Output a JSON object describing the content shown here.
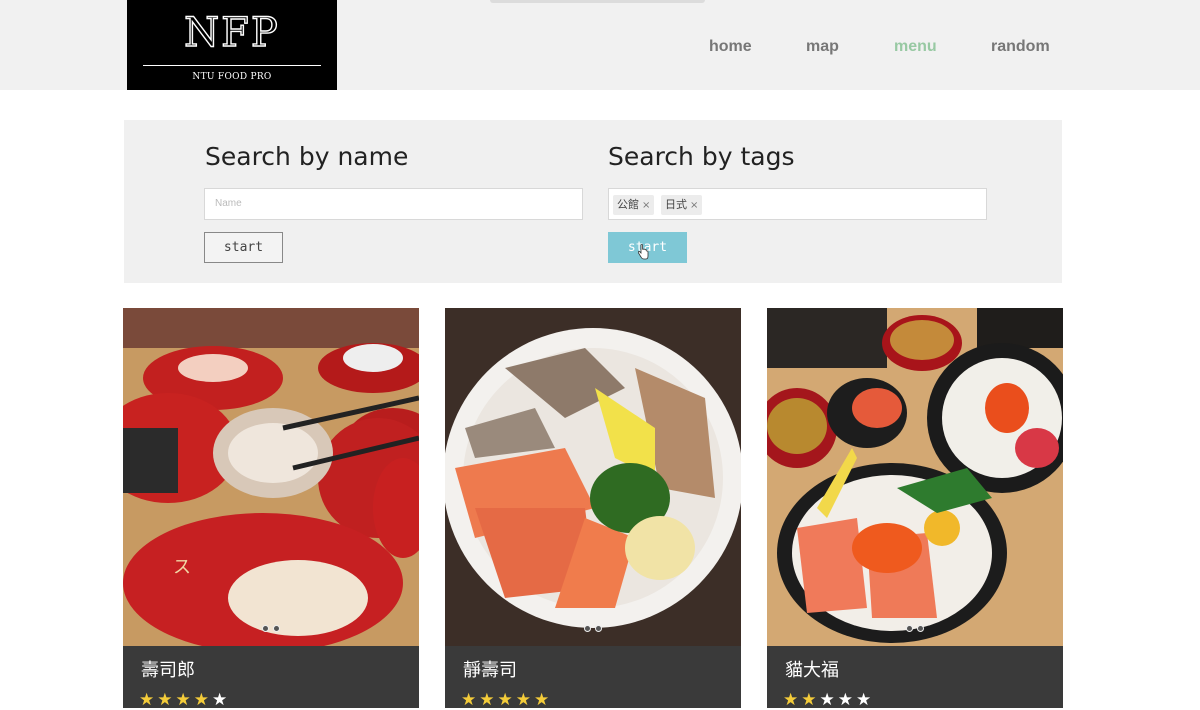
{
  "header": {
    "logo_mark": "NFP",
    "logo_sub": "NTU FOOD PRO",
    "nav": [
      {
        "label": "home",
        "active": false
      },
      {
        "label": "map",
        "active": false
      },
      {
        "label": "menu",
        "active": true
      },
      {
        "label": "random",
        "active": false
      }
    ],
    "active_color": "#98c9a3"
  },
  "search": {
    "by_name": {
      "title": "Search by name",
      "placeholder": "Name",
      "button": "start"
    },
    "by_tags": {
      "title": "Search by tags",
      "tags": [
        {
          "label": "公館",
          "remove": "×"
        },
        {
          "label": "日式",
          "remove": "×"
        }
      ],
      "button": "start",
      "button_color": "#7fc8d6"
    }
  },
  "cards": [
    {
      "name": "壽司郎",
      "rating": 4,
      "max_rating": 5,
      "image": "sushi-conveyor-photo"
    },
    {
      "name": "靜壽司",
      "rating": 5,
      "max_rating": 5,
      "image": "sashimi-platter-photo"
    },
    {
      "name": "貓大福",
      "rating": 2,
      "max_rating": 5,
      "image": "chirashi-don-photo"
    }
  ],
  "colors": {
    "star": "#f4cc3a",
    "card_footer": "#3a3a3a"
  }
}
